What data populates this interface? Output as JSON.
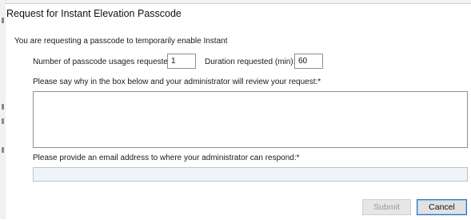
{
  "dialog": {
    "title": "Request for Instant Elevation Passcode",
    "intro": "You are requesting a passcode to temporarily enable Instant",
    "usages_label": "Number of passcode usages requested:",
    "usages_value": "1",
    "duration_label": "Duration requested (min):",
    "duration_value": "60",
    "reason_label": "Please say why in the box below and your administrator will review your request:*",
    "reason_value": "",
    "email_label": "Please provide an email address to where your administrator can respond:*",
    "email_value": "",
    "submit_label": "Submit",
    "cancel_label": "Cancel"
  },
  "colors": {
    "accent_border": "#2c6fbf",
    "disabled_text": "#9a9a9a",
    "email_field_bg": "#f0f4f8"
  }
}
